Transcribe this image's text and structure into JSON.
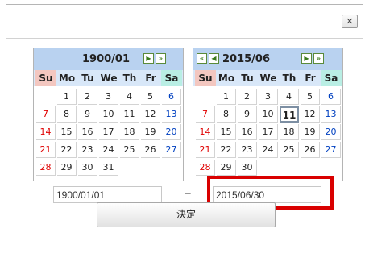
{
  "dialog": {
    "close_label": "✕",
    "submit_label": "決定",
    "separator": "–"
  },
  "calendar_left": {
    "title": "1900/01",
    "nav_next": "▶",
    "nav_next_year": "»",
    "weekdays": [
      "Su",
      "Mo",
      "Tu",
      "We",
      "Th",
      "Fr",
      "Sa"
    ],
    "weeks": [
      [
        "",
        "1",
        "2",
        "3",
        "4",
        "5",
        "6"
      ],
      [
        "7",
        "8",
        "9",
        "10",
        "11",
        "12",
        "13"
      ],
      [
        "14",
        "15",
        "16",
        "17",
        "18",
        "19",
        "20"
      ],
      [
        "21",
        "22",
        "23",
        "24",
        "25",
        "26",
        "27"
      ],
      [
        "28",
        "29",
        "30",
        "31",
        "",
        "",
        ""
      ]
    ]
  },
  "calendar_right": {
    "title": "2015/06",
    "nav_prev_year": "«",
    "nav_prev": "◀",
    "nav_next": "▶",
    "nav_next_year": "»",
    "weekdays": [
      "Su",
      "Mo",
      "Tu",
      "We",
      "Th",
      "Fr",
      "Sa"
    ],
    "today": "11",
    "weeks": [
      [
        "",
        "1",
        "2",
        "3",
        "4",
        "5",
        "6"
      ],
      [
        "7",
        "8",
        "9",
        "10",
        "11",
        "12",
        "13"
      ],
      [
        "14",
        "15",
        "16",
        "17",
        "18",
        "19",
        "20"
      ],
      [
        "21",
        "22",
        "23",
        "24",
        "25",
        "26",
        "27"
      ],
      [
        "28",
        "29",
        "30",
        "",
        "",
        "",
        ""
      ]
    ]
  },
  "inputs": {
    "start_value": "1900/01/01",
    "end_value": "2015/06/30"
  },
  "colors": {
    "header_blue": "#b9d2f0",
    "sunday_bg": "#f3c7c0",
    "saturday_bg": "#b9eee4",
    "highlight_red": "#d90000"
  }
}
